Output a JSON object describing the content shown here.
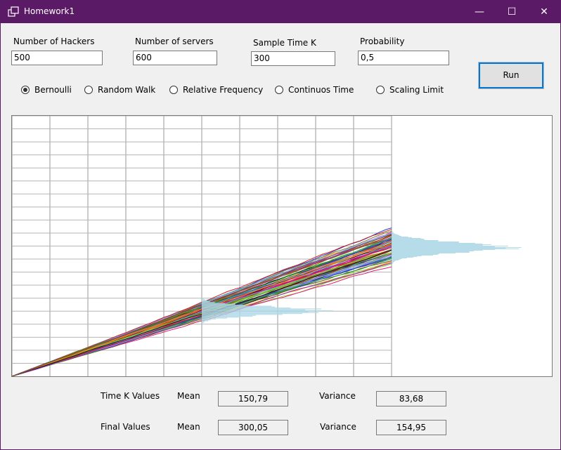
{
  "window": {
    "title": "Homework1",
    "minimize_glyph": "—",
    "maximize_glyph": "☐",
    "close_glyph": "✕"
  },
  "inputs": {
    "hackers": {
      "label": "Number of Hackers",
      "value": "500"
    },
    "servers": {
      "label": "Number of servers",
      "value": "600"
    },
    "sample_time": {
      "label": "Sample Time K",
      "value": "300"
    },
    "probability": {
      "label": "Probability",
      "value": "0,5"
    }
  },
  "run_label": "Run",
  "modes": [
    {
      "label": "Bernoulli",
      "selected": true
    },
    {
      "label": "Random Walk",
      "selected": false
    },
    {
      "label": "Relative Frequency",
      "selected": false
    },
    {
      "label": "Continuos Time",
      "selected": false
    },
    {
      "label": "Scaling Limit",
      "selected": false
    }
  ],
  "stats": {
    "time_k": {
      "label": "Time K Values",
      "mean_label": "Mean",
      "mean": "150,79",
      "variance_label": "Variance",
      "variance": "83,68"
    },
    "final": {
      "label": "Final Values",
      "mean_label": "Mean",
      "mean": "300,05",
      "variance_label": "Variance",
      "variance": "154,95"
    }
  },
  "plot": {
    "line_colors": [
      "#1f3fd1",
      "#d01c1c",
      "#2ca02c",
      "#8c2fbf",
      "#111111",
      "#e0207a",
      "#7a7a22",
      "#3cb8c8",
      "#ff7f0e",
      "#6a4a20",
      "#99cc33",
      "#a0a0ff"
    ],
    "histogram_color": "#add8e6"
  }
}
